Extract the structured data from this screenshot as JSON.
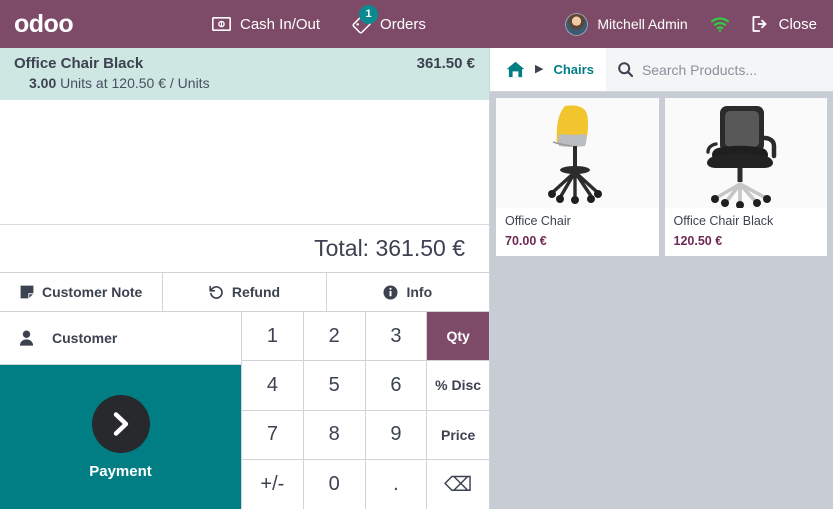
{
  "navbar": {
    "brand": "odoo",
    "cash_in_out": {
      "label": "Cash In/Out",
      "icon": "banknote-icon"
    },
    "orders": {
      "label": "Orders",
      "icon": "ticket-icon",
      "badge": "1"
    },
    "user": {
      "name": "Mitchell Admin",
      "icon": "avatar"
    },
    "network": {
      "icon": "wifi-icon",
      "color": "#2ecc40"
    },
    "close": {
      "label": "Close",
      "icon": "sign-out-icon"
    },
    "bg_color": "#7d4a68"
  },
  "order": {
    "lines": [
      {
        "name": "Office Chair Black",
        "price": "361.50 €",
        "qty": "3.00",
        "detail_mid": "Units at",
        "unit_price": "120.50 €",
        "detail_end": "/ Units"
      }
    ],
    "total_label": "Total: 361.50 €",
    "actions": [
      {
        "label": "Customer Note",
        "icon": "note-icon"
      },
      {
        "label": "Refund",
        "icon": "undo-icon"
      },
      {
        "label": "Info",
        "icon": "info-circle-icon"
      }
    ],
    "customer_button": {
      "label": "Customer",
      "icon": "user-icon"
    },
    "payment_button": {
      "label": "Payment",
      "icon": "chevron-right-icon",
      "color": "#017e84"
    }
  },
  "numpad": {
    "keys": [
      {
        "label": "1",
        "type": "digit"
      },
      {
        "label": "2",
        "type": "digit"
      },
      {
        "label": "3",
        "type": "digit"
      },
      {
        "label": "Qty",
        "type": "mode",
        "active": true
      },
      {
        "label": "4",
        "type": "digit"
      },
      {
        "label": "5",
        "type": "digit"
      },
      {
        "label": "6",
        "type": "digit"
      },
      {
        "label": "% Disc",
        "type": "mode",
        "active": false
      },
      {
        "label": "7",
        "type": "digit"
      },
      {
        "label": "8",
        "type": "digit"
      },
      {
        "label": "9",
        "type": "digit"
      },
      {
        "label": "Price",
        "type": "mode",
        "active": false
      },
      {
        "label": "+/-",
        "type": "digit"
      },
      {
        "label": "0",
        "type": "digit"
      },
      {
        "label": ".",
        "type": "digit"
      },
      {
        "label": "⌫",
        "type": "backspace",
        "icon": "backspace-icon"
      }
    ],
    "active_color": "#7d4a68"
  },
  "products_panel": {
    "breadcrumb": {
      "home_icon": "home-icon",
      "caret": "▶",
      "category": "Chairs"
    },
    "search": {
      "placeholder": "Search Products...",
      "value": "",
      "icon": "search-icon"
    },
    "products": [
      {
        "name": "Office Chair",
        "price": "70.00 €",
        "image": "yellow-office-chair"
      },
      {
        "name": "Office Chair Black",
        "price": "120.50 €",
        "image": "black-office-chair"
      }
    ],
    "bg_color": "#c8ccd4"
  }
}
